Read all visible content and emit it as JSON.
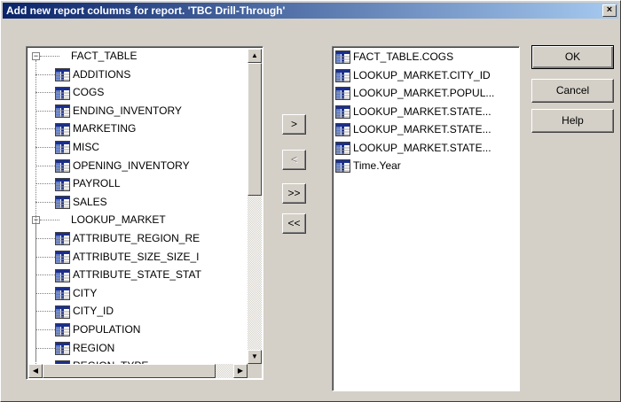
{
  "window": {
    "title": "Add new report columns for report. 'TBC Drill-Through'",
    "close_label": "×"
  },
  "tree": {
    "groups": [
      {
        "label": "FACT_TABLE",
        "expander": "−",
        "items": [
          "ADDITIONS",
          "COGS",
          "ENDING_INVENTORY",
          "MARKETING",
          "MISC",
          "OPENING_INVENTORY",
          "PAYROLL",
          "SALES"
        ]
      },
      {
        "label": "LOOKUP_MARKET",
        "expander": "−",
        "items": [
          "ATTRIBUTE_REGION_RE",
          "ATTRIBUTE_SIZE_SIZE_I",
          "ATTRIBUTE_STATE_STAT",
          "CITY",
          "CITY_ID",
          "POPULATION",
          "REGION",
          "REGION_TYPE"
        ]
      }
    ],
    "scroll_up": "▲",
    "scroll_down": "▼",
    "scroll_left": "◀",
    "scroll_right": "▶"
  },
  "transfer_buttons": {
    "add": ">",
    "remove": "<",
    "add_all": ">>",
    "remove_all": "<<"
  },
  "selected_columns": [
    "FACT_TABLE.COGS",
    "LOOKUP_MARKET.CITY_ID",
    "LOOKUP_MARKET.POPUL...",
    "LOOKUP_MARKET.STATE...",
    "LOOKUP_MARKET.STATE...",
    "LOOKUP_MARKET.STATE...",
    "Time.Year"
  ],
  "dialog_buttons": {
    "ok": "OK",
    "cancel": "Cancel",
    "help": "Help"
  },
  "icons": {
    "field": "table-column-icon"
  },
  "colors": {
    "title_start": "#0a246a",
    "title_end": "#a6caf0",
    "dialog_bg": "#d4d0c8"
  }
}
